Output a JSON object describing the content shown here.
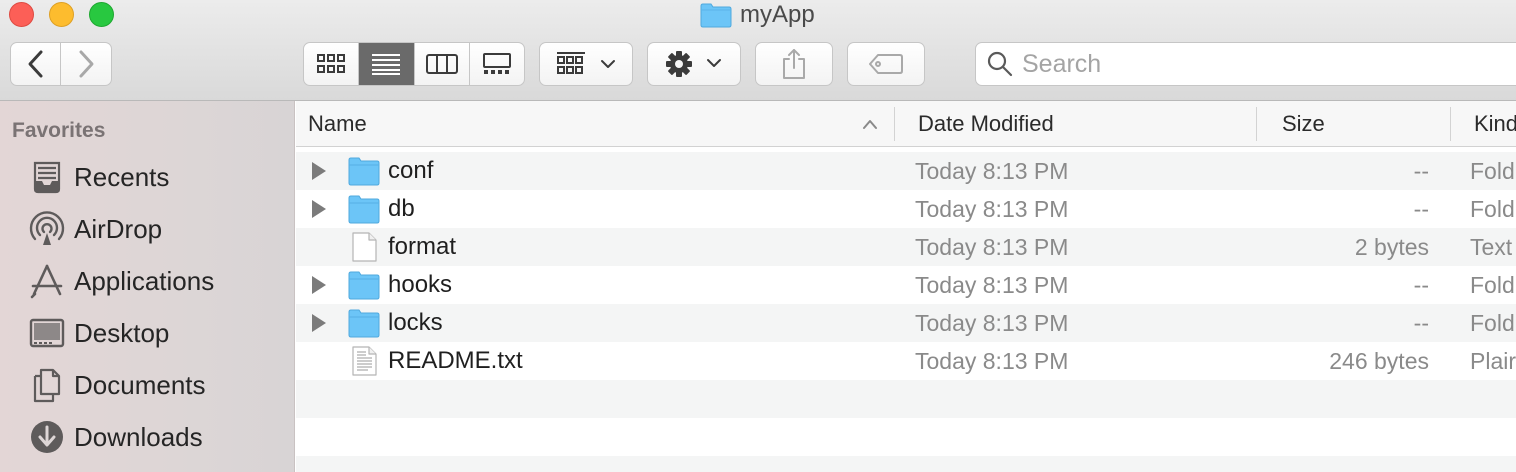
{
  "window": {
    "title": "myApp"
  },
  "search": {
    "placeholder": "Search",
    "value": ""
  },
  "sidebar": {
    "heading": "Favorites",
    "items": [
      {
        "label": "Recents",
        "icon": "recents-icon"
      },
      {
        "label": "AirDrop",
        "icon": "airdrop-icon"
      },
      {
        "label": "Applications",
        "icon": "applications-icon"
      },
      {
        "label": "Desktop",
        "icon": "desktop-icon"
      },
      {
        "label": "Documents",
        "icon": "documents-icon"
      },
      {
        "label": "Downloads",
        "icon": "downloads-icon"
      }
    ]
  },
  "columns": {
    "name": "Name",
    "date": "Date Modified",
    "size": "Size",
    "kind": "Kind"
  },
  "files": [
    {
      "name": "conf",
      "date": "Today 8:13 PM",
      "size": "--",
      "kind": "Fold",
      "type": "folder"
    },
    {
      "name": "db",
      "date": "Today 8:13 PM",
      "size": "--",
      "kind": "Fold",
      "type": "folder"
    },
    {
      "name": "format",
      "date": "Today 8:13 PM",
      "size": "2 bytes",
      "kind": "Text",
      "type": "file"
    },
    {
      "name": "hooks",
      "date": "Today 8:13 PM",
      "size": "--",
      "kind": "Fold",
      "type": "folder"
    },
    {
      "name": "locks",
      "date": "Today 8:13 PM",
      "size": "--",
      "kind": "Fold",
      "type": "folder"
    },
    {
      "name": "README.txt",
      "date": "Today 8:13 PM",
      "size": "246 bytes",
      "kind": "Plair",
      "type": "text-file"
    }
  ],
  "colors": {
    "folder": "#6cc5f7",
    "active_view": "#6a6a6a",
    "close": "#fc5f57",
    "minimize": "#fdbc2e",
    "zoom": "#28c840"
  }
}
